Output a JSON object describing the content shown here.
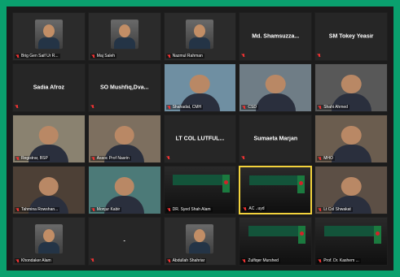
{
  "tiles": [
    {
      "name": "Brig Gen Saif Ur R...",
      "kind": "avatar",
      "bg": "#2b2b2b"
    },
    {
      "name": "Maj Saleh",
      "kind": "avatar",
      "bg": "#2b2b2b"
    },
    {
      "name": "Nazmul Rahman",
      "kind": "avatar",
      "bg": "#2b2b2b"
    },
    {
      "center": "Md. Shamsuzza...",
      "name": "",
      "kind": "center"
    },
    {
      "center": "SM Tokey Yeasir",
      "name": "",
      "kind": "center"
    },
    {
      "center": "Sadia Afroz",
      "name": "",
      "kind": "center"
    },
    {
      "center": "SO Mushfiq,Dva...",
      "name": "",
      "kind": "center"
    },
    {
      "name": "Shahadat, CMH",
      "kind": "video",
      "bg": "#6f8fa2"
    },
    {
      "name": "CSD",
      "kind": "video",
      "bg": "#6f7d86"
    },
    {
      "name": "Shahi Ahmed",
      "kind": "video",
      "bg": "#585858"
    },
    {
      "name": "Registrar, BSP",
      "kind": "video",
      "bg": "#8a8270"
    },
    {
      "name": "Assoc Prof Nasrin",
      "kind": "video",
      "bg": "#7d6f5f"
    },
    {
      "center": "LT COL LUTFUL...",
      "name": "",
      "kind": "center"
    },
    {
      "center": "Sumaeta Marjan",
      "name": "",
      "kind": "center"
    },
    {
      "name": "MHO",
      "kind": "video",
      "bg": "#6b5d4f"
    },
    {
      "name": "Tahmina Rowshan...",
      "kind": "video",
      "bg": "#4d4036"
    },
    {
      "name": "Monjur Kabir",
      "kind": "video",
      "bg": "#4c7a78"
    },
    {
      "name": "DR. Syed Shah Alam",
      "kind": "banner",
      "bg": "#202020"
    },
    {
      "name": "AC ..uyd",
      "kind": "banner",
      "bg": "#1f1f1f",
      "active": true
    },
    {
      "name": "Lt Col Shwakat",
      "kind": "video",
      "bg": "#5c4f45"
    },
    {
      "name": "Khondaker Alam",
      "kind": "avatar",
      "bg": "#2b2b2b"
    },
    {
      "center": "-",
      "name": "",
      "kind": "center"
    },
    {
      "name": "Abdullah Shahriar",
      "kind": "avatar",
      "bg": "#2b2b2b"
    },
    {
      "name": "Zulfiqer Murshed",
      "kind": "banner",
      "bg": "#1f1f1f"
    },
    {
      "name": "Prof. Dr. Kashem ...",
      "kind": "banner",
      "bg": "#1f1f1f"
    }
  ]
}
